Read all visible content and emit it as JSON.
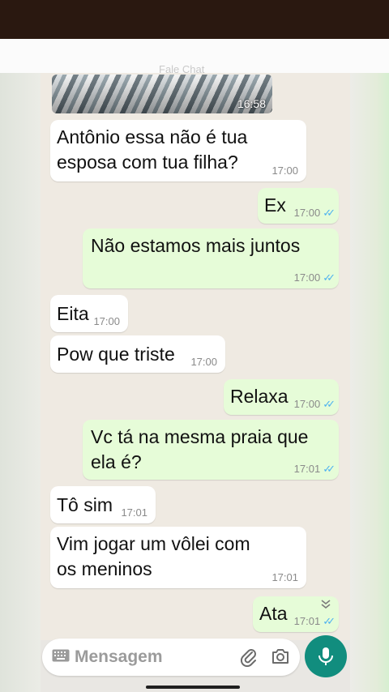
{
  "image_message": {
    "time": "16:58",
    "faint_label": "Fale Chat"
  },
  "messages": [
    {
      "dir": "in",
      "text": "Antônio essa não é tua\nesposa com tua filha?",
      "time": "17:00"
    },
    {
      "dir": "out",
      "text": "Ex",
      "time": "17:00"
    },
    {
      "dir": "out",
      "text": "Não estamos mais juntos",
      "time": "17:00"
    },
    {
      "dir": "in",
      "text": "Eita",
      "time": "17:00"
    },
    {
      "dir": "in",
      "text": "Pow que triste",
      "time": "17:00"
    },
    {
      "dir": "out",
      "text": "Relaxa",
      "time": "17:00"
    },
    {
      "dir": "out",
      "text": "Vc tá na mesma praia que\nela é?",
      "time": "17:01"
    },
    {
      "dir": "in",
      "text": "Tô sim",
      "time": "17:01"
    },
    {
      "dir": "in",
      "text": "Vim jogar um vôlei com\nos meninos",
      "time": "17:01"
    },
    {
      "dir": "out",
      "text": "Ata",
      "time": "17:01"
    }
  ],
  "composer": {
    "placeholder": "Mensagem"
  },
  "icons": {
    "keyboard": "keyboard-icon",
    "attach": "paperclip-icon",
    "camera": "camera-icon",
    "mic": "mic-icon",
    "scroll": "double-chevron-down-icon",
    "read": "double-check-icon"
  },
  "colors": {
    "outgoing_bubble": "#e6fcd8",
    "incoming_bubble": "#ffffff",
    "mic_button": "#118d7e",
    "read_ticks": "#4fb3f0"
  }
}
